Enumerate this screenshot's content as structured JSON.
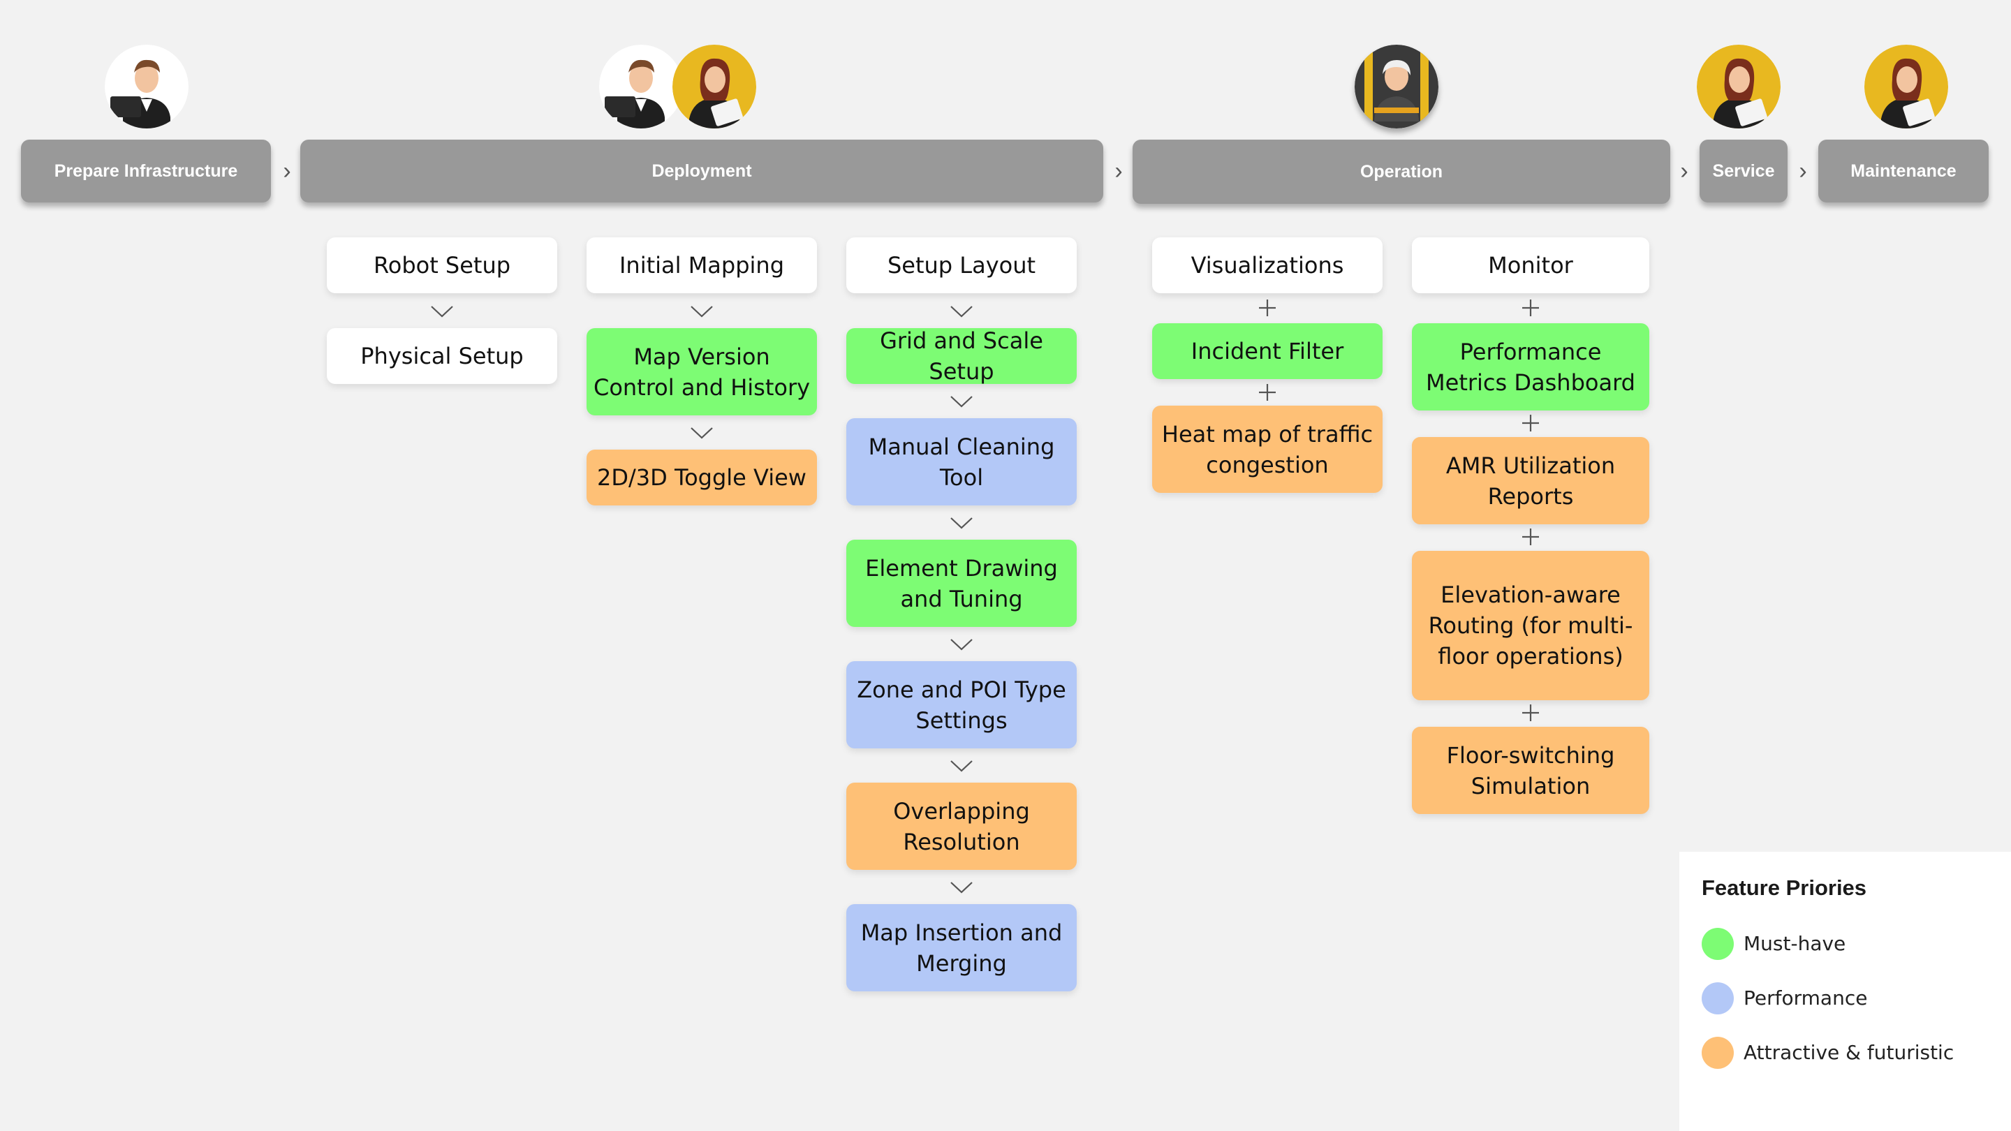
{
  "phases": {
    "prepare": "Prepare Infrastructure",
    "deployment": "Deployment",
    "operation": "Operation",
    "service": "Service",
    "maintenance": "Maintenance"
  },
  "columns": {
    "robot_setup": {
      "header": "Robot Setup",
      "items": [
        "Physical Setup"
      ]
    },
    "initial_mapping": {
      "header": "Initial Mapping",
      "items": [
        "Map Version Control and History",
        "2D/3D Toggle View"
      ]
    },
    "setup_layout": {
      "header": "Setup Layout",
      "items": [
        "Grid and Scale Setup",
        "Manual Cleaning Tool",
        "Element Drawing and Tuning",
        "Zone and POI Type Settings",
        "Overlapping Resolution",
        "Map Insertion and Merging"
      ]
    },
    "visualizations": {
      "header": "Visualizations",
      "items": [
        "Incident Filter",
        "Heat map of traffic congestion"
      ]
    },
    "monitor": {
      "header": "Monitor",
      "items": [
        "Performance Metrics Dashboard",
        "AMR Utilization Reports",
        "Elevation-aware Routing (for multi-floor operations)",
        "Floor-switching Simulation"
      ]
    }
  },
  "legend": {
    "title": "Feature Priories",
    "items": [
      {
        "label": "Must-have",
        "color": "#7dfc74"
      },
      {
        "label": "Performance",
        "color": "#b3c8f7"
      },
      {
        "label": "Attractive & futuristic",
        "color": "#fec076"
      }
    ]
  },
  "colors": {
    "must_have": "#7dfc74",
    "performance": "#b3c8f7",
    "attractive": "#fec076",
    "phase_bar": "#999999",
    "background": "#f2f2f2"
  },
  "icons": {
    "separator": "chevron-right-icon",
    "flow_connector": "chevron-down-icon",
    "group_connector": "plus-icon"
  }
}
